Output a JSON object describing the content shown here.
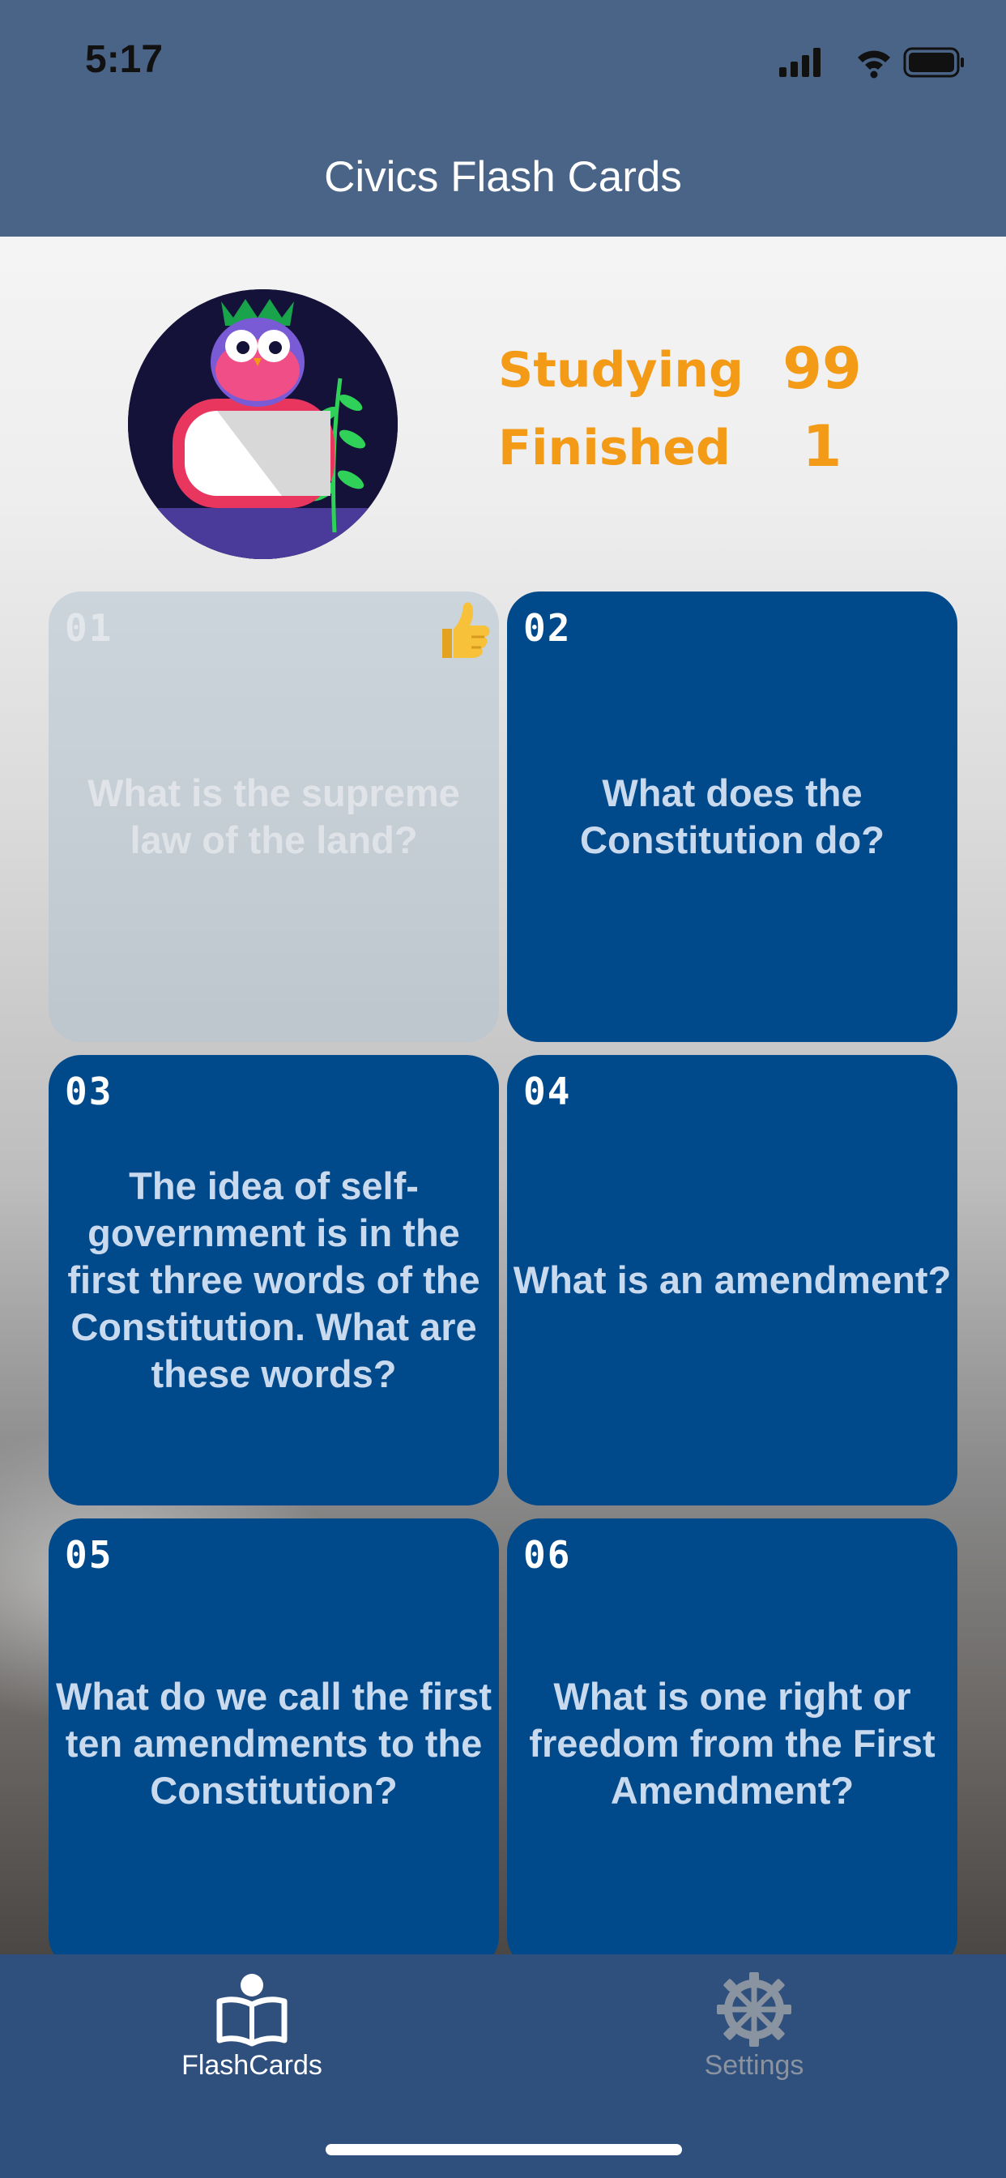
{
  "status_bar": {
    "time": "5:17"
  },
  "nav": {
    "title": "Civics Flash Cards"
  },
  "stats": {
    "studying_label": "Studying",
    "studying_value": "99",
    "finished_label": "Finished",
    "finished_value": "1"
  },
  "cards": [
    {
      "number": "01",
      "question": "What is the supreme law of the land?",
      "done": true
    },
    {
      "number": "02",
      "question": "What does the Constitution do?",
      "done": false
    },
    {
      "number": "03",
      "question": "The idea of self-government is in the first three words of the Constitution. What are these words?",
      "done": false
    },
    {
      "number": "04",
      "question": "What is an amendment?",
      "done": false
    },
    {
      "number": "05",
      "question": "What do we call the first ten amendments to the Constitution?",
      "done": false
    },
    {
      "number": "06",
      "question": "What is one right or freedom from the First Amendment?",
      "done": false
    }
  ],
  "tabs": [
    {
      "label": "FlashCards",
      "icon": "reader-book-icon",
      "active": true
    },
    {
      "label": "Settings",
      "icon": "gear-icon",
      "active": false
    }
  ],
  "colors": {
    "nav_bg": "#4a6488",
    "card_bg": "#004a8c",
    "accent_orange": "#f39a17",
    "tab_bar_bg": "#2f4f7d"
  }
}
